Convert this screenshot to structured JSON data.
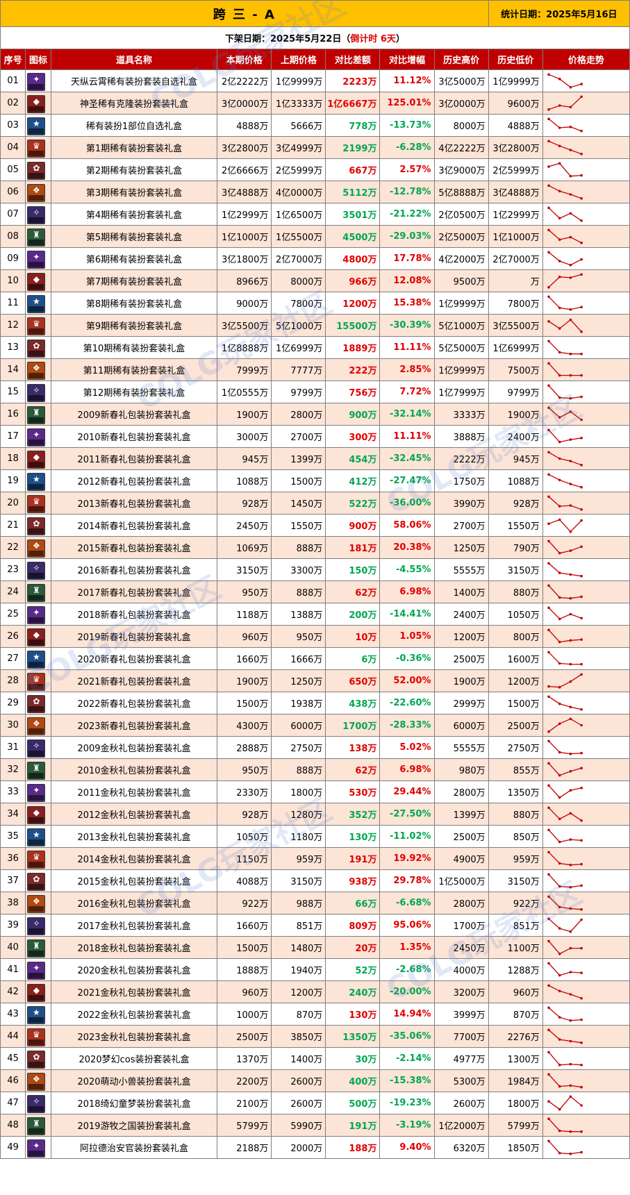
{
  "title": "跨 三 - A",
  "stat_date": "统计日期：2025年5月16日",
  "notice": {
    "prefix": "下架日期：2025年5月22日（",
    "countdown": "倒计时 6天",
    "suffix": "）"
  },
  "columns": [
    "序号",
    "图标",
    "道具名称",
    "本期价格",
    "上期价格",
    "对比差额",
    "对比增幅",
    "历史高价",
    "历史低价",
    "价格走势"
  ],
  "colors": {
    "title_bg": "#ffc000",
    "header_bg": "#c00000",
    "row_alt_bg": "#fce4d6",
    "up": "#e00000",
    "down": "#00a650",
    "trend_line": "#c00000"
  },
  "rows": [
    {
      "seq": "01",
      "icon": "cloud-armor-icon",
      "name": "天纵云霄稀有装扮套装自选礼盒",
      "cur": "2亿2222万",
      "prev": "1亿9999万",
      "diff": "2223万",
      "pct": "11.12%",
      "dir": "up",
      "high": "3亿5000万",
      "low": "1亿9999万",
      "trend": [
        0.9,
        0.62,
        0.1,
        0.3
      ]
    },
    {
      "seq": "02",
      "icon": "holy-clone-icon",
      "name": "神圣稀有克隆装扮套装礼盒",
      "cur": "3亿0000万",
      "prev": "1亿3333万",
      "diff": "1亿6667万",
      "pct": "125.01%",
      "dir": "up",
      "high": "3亿0000万",
      "low": "9600万",
      "trend": [
        0.1,
        0.35,
        0.25,
        0.9
      ]
    },
    {
      "seq": "03",
      "icon": "rare-part-icon",
      "name": "稀有装扮1部位自选礼盒",
      "cur": "4888万",
      "prev": "5666万",
      "diff": "778万",
      "pct": "-13.73%",
      "dir": "down",
      "high": "8000万",
      "low": "4888万",
      "trend": [
        0.9,
        0.35,
        0.4,
        0.15
      ]
    },
    {
      "seq": "04",
      "icon": "gift-box-1-icon",
      "name": "第1期稀有装扮套装礼盒",
      "cur": "3亿2800万",
      "prev": "3亿4999万",
      "diff": "2199万",
      "pct": "-6.28%",
      "dir": "down",
      "high": "4亿2222万",
      "low": "3亿2800万",
      "trend": [
        0.9,
        0.6,
        0.35,
        0.1
      ]
    },
    {
      "seq": "05",
      "icon": "gift-box-2-icon",
      "name": "第2期稀有装扮套装礼盒",
      "cur": "2亿6666万",
      "prev": "2亿5999万",
      "diff": "667万",
      "pct": "2.57%",
      "dir": "up",
      "high": "3亿9000万",
      "low": "2亿5999万",
      "trend": [
        0.7,
        0.9,
        0.1,
        0.15
      ]
    },
    {
      "seq": "06",
      "icon": "gift-box-3-icon",
      "name": "第3期稀有装扮套装礼盒",
      "cur": "3亿4888万",
      "prev": "4亿0000万",
      "diff": "5112万",
      "pct": "-12.78%",
      "dir": "down",
      "high": "5亿8888万",
      "low": "3亿4888万",
      "trend": [
        0.9,
        0.55,
        0.35,
        0.1
      ]
    },
    {
      "seq": "07",
      "icon": "gift-box-4-icon",
      "name": "第4期稀有装扮套装礼盒",
      "cur": "1亿2999万",
      "prev": "1亿6500万",
      "diff": "3501万",
      "pct": "-21.22%",
      "dir": "down",
      "high": "2亿0500万",
      "low": "1亿2999万",
      "trend": [
        0.9,
        0.25,
        0.55,
        0.1
      ]
    },
    {
      "seq": "08",
      "icon": "gift-box-5-icon",
      "name": "第5期稀有装扮套装礼盒",
      "cur": "1亿1000万",
      "prev": "1亿5500万",
      "diff": "4500万",
      "pct": "-29.03%",
      "dir": "down",
      "high": "2亿5000万",
      "low": "1亿1000万",
      "trend": [
        0.9,
        0.3,
        0.45,
        0.1
      ]
    },
    {
      "seq": "09",
      "icon": "gift-box-6-icon",
      "name": "第6期稀有装扮套装礼盒",
      "cur": "3亿1800万",
      "prev": "2亿7000万",
      "diff": "4800万",
      "pct": "17.78%",
      "dir": "up",
      "high": "4亿2000万",
      "low": "2亿7000万",
      "trend": [
        0.9,
        0.35,
        0.1,
        0.45
      ]
    },
    {
      "seq": "10",
      "icon": "gift-box-7-icon",
      "name": "第7期稀有装扮套装礼盒",
      "cur": "8966万",
      "prev": "8000万",
      "diff": "966万",
      "pct": "12.08%",
      "dir": "up",
      "high": "9500万",
      "low": "万",
      "trend": [
        0.1,
        0.75,
        0.7,
        0.9
      ]
    },
    {
      "seq": "11",
      "icon": "gift-box-8-icon",
      "name": "第8期稀有装扮套装礼盒",
      "cur": "9000万",
      "prev": "7800万",
      "diff": "1200万",
      "pct": "15.38%",
      "dir": "up",
      "high": "1亿9999万",
      "low": "7800万",
      "trend": [
        0.9,
        0.2,
        0.1,
        0.25
      ]
    },
    {
      "seq": "12",
      "icon": "gift-box-9-icon",
      "name": "第9期稀有装扮套装礼盒",
      "cur": "3亿5500万",
      "prev": "5亿1000万",
      "diff": "15500万",
      "pct": "-30.39%",
      "dir": "down",
      "high": "5亿1000万",
      "low": "3亿5500万",
      "trend": [
        0.75,
        0.3,
        0.85,
        0.1
      ]
    },
    {
      "seq": "13",
      "icon": "gift-box-10-icon",
      "name": "第10期稀有装扮套装礼盒",
      "cur": "1亿8888万",
      "prev": "1亿6999万",
      "diff": "1889万",
      "pct": "11.11%",
      "dir": "up",
      "high": "5亿5000万",
      "low": "1亿6999万",
      "trend": [
        0.9,
        0.2,
        0.1,
        0.1
      ]
    },
    {
      "seq": "14",
      "icon": "gift-box-11-icon",
      "name": "第11期稀有装扮套装礼盒",
      "cur": "7999万",
      "prev": "7777万",
      "diff": "222万",
      "pct": "2.85%",
      "dir": "up",
      "high": "1亿9999万",
      "low": "7500万",
      "trend": [
        0.9,
        0.15,
        0.15,
        0.15
      ]
    },
    {
      "seq": "15",
      "icon": "gift-box-12-icon",
      "name": "第12期稀有装扮套装礼盒",
      "cur": "1亿0555万",
      "prev": "9799万",
      "diff": "756万",
      "pct": "7.72%",
      "dir": "up",
      "high": "1亿7999万",
      "low": "9799万",
      "trend": [
        0.9,
        0.15,
        0.1,
        0.2
      ]
    },
    {
      "seq": "16",
      "icon": "spring-2009-icon",
      "name": "2009新春礼包装扮套装礼盒",
      "cur": "1900万",
      "prev": "2800万",
      "diff": "900万",
      "pct": "-32.14%",
      "dir": "down",
      "high": "3333万",
      "low": "1900万",
      "trend": [
        0.9,
        0.3,
        0.65,
        0.15
      ]
    },
    {
      "seq": "17",
      "icon": "spring-2010-icon",
      "name": "2010新春礼包装扮套装礼盒",
      "cur": "3000万",
      "prev": "2700万",
      "diff": "300万",
      "pct": "11.11%",
      "dir": "up",
      "high": "3888万",
      "low": "2400万",
      "trend": [
        0.9,
        0.15,
        0.3,
        0.4
      ]
    },
    {
      "seq": "18",
      "icon": "spring-2011-icon",
      "name": "2011新春礼包装扮套装礼盒",
      "cur": "945万",
      "prev": "1399万",
      "diff": "454万",
      "pct": "-32.45%",
      "dir": "down",
      "high": "2222万",
      "low": "945万",
      "trend": [
        0.9,
        0.5,
        0.35,
        0.1
      ]
    },
    {
      "seq": "19",
      "icon": "spring-2012-icon",
      "name": "2012新春礼包装扮套装礼盒",
      "cur": "1088万",
      "prev": "1500万",
      "diff": "412万",
      "pct": "-27.47%",
      "dir": "down",
      "high": "1750万",
      "low": "1088万",
      "trend": [
        0.9,
        0.55,
        0.3,
        0.1
      ]
    },
    {
      "seq": "20",
      "icon": "spring-2013-icon",
      "name": "2013新春礼包装扮套装礼盒",
      "cur": "928万",
      "prev": "1450万",
      "diff": "522万",
      "pct": "-36.00%",
      "dir": "down",
      "high": "3990万",
      "low": "928万",
      "trend": [
        0.9,
        0.3,
        0.35,
        0.1
      ]
    },
    {
      "seq": "21",
      "icon": "spring-2014-icon",
      "name": "2014新春礼包装扮套装礼盒",
      "cur": "2450万",
      "prev": "1550万",
      "diff": "900万",
      "pct": "58.06%",
      "dir": "up",
      "high": "2700万",
      "low": "1550万",
      "trend": [
        0.6,
        0.85,
        0.1,
        0.8
      ]
    },
    {
      "seq": "22",
      "icon": "spring-2015-icon",
      "name": "2015新春礼包装扮套装礼盒",
      "cur": "1069万",
      "prev": "888万",
      "diff": "181万",
      "pct": "20.38%",
      "dir": "up",
      "high": "1250万",
      "low": "790万",
      "trend": [
        0.9,
        0.15,
        0.3,
        0.55
      ]
    },
    {
      "seq": "23",
      "icon": "spring-2016-icon",
      "name": "2016新春礼包装扮套装礼盒",
      "cur": "3150万",
      "prev": "3300万",
      "diff": "150万",
      "pct": "-4.55%",
      "dir": "down",
      "high": "5555万",
      "low": "3150万",
      "trend": [
        0.9,
        0.3,
        0.2,
        0.1
      ]
    },
    {
      "seq": "24",
      "icon": "spring-2017-icon",
      "name": "2017新春礼包装扮套装礼盒",
      "cur": "950万",
      "prev": "888万",
      "diff": "62万",
      "pct": "6.98%",
      "dir": "up",
      "high": "1400万",
      "low": "880万",
      "trend": [
        0.9,
        0.15,
        0.1,
        0.2
      ]
    },
    {
      "seq": "25",
      "icon": "spring-2018-icon",
      "name": "2018新春礼包装扮套装礼盒",
      "cur": "1188万",
      "prev": "1388万",
      "diff": "200万",
      "pct": "-14.41%",
      "dir": "down",
      "high": "2400万",
      "low": "1050万",
      "trend": [
        0.9,
        0.2,
        0.5,
        0.25
      ]
    },
    {
      "seq": "26",
      "icon": "spring-2019-icon",
      "name": "2019新春礼包装扮套装礼盒",
      "cur": "960万",
      "prev": "950万",
      "diff": "10万",
      "pct": "1.05%",
      "dir": "up",
      "high": "1200万",
      "low": "800万",
      "trend": [
        0.9,
        0.15,
        0.25,
        0.3
      ]
    },
    {
      "seq": "27",
      "icon": "spring-2020-icon",
      "name": "2020新春礼包装扮套装礼盒",
      "cur": "1660万",
      "prev": "1666万",
      "diff": "6万",
      "pct": "-0.36%",
      "dir": "down",
      "high": "2500万",
      "low": "1600万",
      "trend": [
        0.9,
        0.2,
        0.15,
        0.15
      ]
    },
    {
      "seq": "28",
      "icon": "spring-2021-icon",
      "name": "2021新春礼包装扮套装礼盒",
      "cur": "1900万",
      "prev": "1250万",
      "diff": "650万",
      "pct": "52.00%",
      "dir": "up",
      "high": "1900万",
      "low": "1200万",
      "trend": [
        0.15,
        0.1,
        0.45,
        0.9
      ]
    },
    {
      "seq": "29",
      "icon": "spring-2022-icon",
      "name": "2022新春礼包装扮套装礼盒",
      "cur": "1500万",
      "prev": "1938万",
      "diff": "438万",
      "pct": "-22.60%",
      "dir": "down",
      "high": "2999万",
      "low": "1500万",
      "trend": [
        0.9,
        0.45,
        0.25,
        0.1
      ]
    },
    {
      "seq": "30",
      "icon": "spring-2023-icon",
      "name": "2023新春礼包装扮套装礼盒",
      "cur": "4300万",
      "prev": "6000万",
      "diff": "1700万",
      "pct": "-28.33%",
      "dir": "down",
      "high": "6000万",
      "low": "2500万",
      "trend": [
        0.1,
        0.6,
        0.9,
        0.5
      ]
    },
    {
      "seq": "31",
      "icon": "autumn-2009-icon",
      "name": "2009金秋礼包装扮套装礼盒",
      "cur": "2888万",
      "prev": "2750万",
      "diff": "138万",
      "pct": "5.02%",
      "dir": "up",
      "high": "5555万",
      "low": "2750万",
      "trend": [
        0.9,
        0.2,
        0.1,
        0.15
      ]
    },
    {
      "seq": "32",
      "icon": "autumn-2010-icon",
      "name": "2010金秋礼包装扮套装礼盒",
      "cur": "950万",
      "prev": "888万",
      "diff": "62万",
      "pct": "6.98%",
      "dir": "up",
      "high": "980万",
      "low": "855万",
      "trend": [
        0.9,
        0.15,
        0.4,
        0.6
      ]
    },
    {
      "seq": "33",
      "icon": "autumn-2011-icon",
      "name": "2011金秋礼包装扮套装礼盒",
      "cur": "2330万",
      "prev": "1800万",
      "diff": "530万",
      "pct": "29.44%",
      "dir": "up",
      "high": "2800万",
      "low": "1350万",
      "trend": [
        0.9,
        0.15,
        0.6,
        0.75
      ]
    },
    {
      "seq": "34",
      "icon": "autumn-2012-icon",
      "name": "2012金秋礼包装扮套装礼盒",
      "cur": "928万",
      "prev": "1280万",
      "diff": "352万",
      "pct": "-27.50%",
      "dir": "down",
      "high": "1399万",
      "low": "880万",
      "trend": [
        0.9,
        0.2,
        0.55,
        0.1
      ]
    },
    {
      "seq": "35",
      "icon": "autumn-2013-icon",
      "name": "2013金秋礼包装扮套装礼盒",
      "cur": "1050万",
      "prev": "1180万",
      "diff": "130万",
      "pct": "-11.02%",
      "dir": "down",
      "high": "2500万",
      "low": "850万",
      "trend": [
        0.9,
        0.15,
        0.3,
        0.25
      ]
    },
    {
      "seq": "36",
      "icon": "autumn-2014-icon",
      "name": "2014金秋礼包装扮套装礼盒",
      "cur": "1150万",
      "prev": "959万",
      "diff": "191万",
      "pct": "19.92%",
      "dir": "up",
      "high": "4900万",
      "low": "959万",
      "trend": [
        0.9,
        0.2,
        0.1,
        0.15
      ]
    },
    {
      "seq": "37",
      "icon": "autumn-2015-icon",
      "name": "2015金秋礼包装扮套装礼盒",
      "cur": "4088万",
      "prev": "3150万",
      "diff": "938万",
      "pct": "29.78%",
      "dir": "up",
      "high": "1亿5000万",
      "low": "3150万",
      "trend": [
        0.9,
        0.15,
        0.1,
        0.2
      ]
    },
    {
      "seq": "38",
      "icon": "autumn-2016-icon",
      "name": "2016金秋礼包装扮套装礼盒",
      "cur": "922万",
      "prev": "988万",
      "diff": "66万",
      "pct": "-6.68%",
      "dir": "down",
      "high": "2800万",
      "low": "922万",
      "trend": [
        0.9,
        0.25,
        0.15,
        0.1
      ]
    },
    {
      "seq": "39",
      "icon": "autumn-2017-icon",
      "name": "2017金秋礼包装扮套装礼盒",
      "cur": "1660万",
      "prev": "851万",
      "diff": "809万",
      "pct": "95.06%",
      "dir": "up",
      "high": "1700万",
      "low": "851万",
      "trend": [
        0.9,
        0.3,
        0.1,
        0.85
      ]
    },
    {
      "seq": "40",
      "icon": "autumn-2018-icon",
      "name": "2018金秋礼包装扮套装礼盒",
      "cur": "1500万",
      "prev": "1480万",
      "diff": "20万",
      "pct": "1.35%",
      "dir": "up",
      "high": "2450万",
      "low": "1100万",
      "trend": [
        0.9,
        0.1,
        0.45,
        0.45
      ]
    },
    {
      "seq": "41",
      "icon": "autumn-2020-icon",
      "name": "2020金秋礼包装扮套装礼盒",
      "cur": "1888万",
      "prev": "1940万",
      "diff": "52万",
      "pct": "-2.68%",
      "dir": "down",
      "high": "4000万",
      "low": "1288万",
      "trend": [
        0.9,
        0.15,
        0.35,
        0.3
      ]
    },
    {
      "seq": "42",
      "icon": "autumn-2021-icon",
      "name": "2021金秋礼包装扮套装礼盒",
      "cur": "960万",
      "prev": "1200万",
      "diff": "240万",
      "pct": "-20.00%",
      "dir": "down",
      "high": "3200万",
      "low": "960万",
      "trend": [
        0.9,
        0.55,
        0.35,
        0.1
      ]
    },
    {
      "seq": "43",
      "icon": "autumn-2022-icon",
      "name": "2022金秋礼包装扮套装礼盒",
      "cur": "1000万",
      "prev": "870万",
      "diff": "130万",
      "pct": "14.94%",
      "dir": "up",
      "high": "3999万",
      "low": "870万",
      "trend": [
        0.9,
        0.3,
        0.1,
        0.15
      ]
    },
    {
      "seq": "44",
      "icon": "autumn-2023-icon",
      "name": "2023金秋礼包装扮套装礼盒",
      "cur": "2500万",
      "prev": "3850万",
      "diff": "1350万",
      "pct": "-35.06%",
      "dir": "down",
      "high": "7700万",
      "low": "2276万",
      "trend": [
        0.9,
        0.3,
        0.2,
        0.1
      ]
    },
    {
      "seq": "45",
      "icon": "dream-cos-icon",
      "name": "2020梦幻cos装扮套装礼盒",
      "cur": "1370万",
      "prev": "1400万",
      "diff": "30万",
      "pct": "-2.14%",
      "dir": "down",
      "high": "4977万",
      "low": "1300万",
      "trend": [
        0.9,
        0.1,
        0.15,
        0.1
      ]
    },
    {
      "seq": "46",
      "icon": "cute-beast-icon",
      "name": "2020萌动小兽装扮套装礼盒",
      "cur": "2200万",
      "prev": "2600万",
      "diff": "400万",
      "pct": "-15.38%",
      "dir": "down",
      "high": "5300万",
      "low": "1984万",
      "trend": [
        0.9,
        0.15,
        0.2,
        0.1
      ]
    },
    {
      "seq": "47",
      "icon": "fairy-dream-icon",
      "name": "2018绮幻童梦装扮套装礼盒",
      "cur": "2100万",
      "prev": "2600万",
      "diff": "500万",
      "pct": "-19.23%",
      "dir": "down",
      "high": "2600万",
      "low": "1800万",
      "trend": [
        0.6,
        0.1,
        0.9,
        0.35
      ]
    },
    {
      "seq": "48",
      "icon": "nomad-kingdom-icon",
      "name": "2019游牧之国装扮套装礼盒",
      "cur": "5799万",
      "prev": "5990万",
      "diff": "191万",
      "pct": "-3.19%",
      "dir": "down",
      "high": "1亿2000万",
      "low": "5799万",
      "trend": [
        0.9,
        0.15,
        0.1,
        0.1
      ]
    },
    {
      "seq": "49",
      "icon": "arad-guard-icon",
      "name": "阿拉德治安官装扮套装礼盒",
      "cur": "2188万",
      "prev": "2000万",
      "diff": "188万",
      "pct": "9.40%",
      "dir": "up",
      "high": "6320万",
      "low": "1850万",
      "trend": [
        0.9,
        0.15,
        0.1,
        0.2
      ]
    }
  ]
}
